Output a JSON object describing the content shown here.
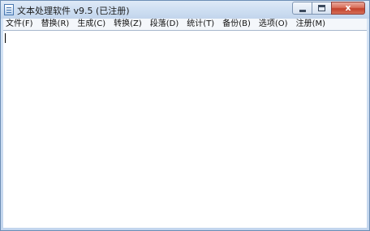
{
  "window": {
    "title": "文本处理软件 v9.5 (已注册)",
    "icon": "document-icon",
    "caption_buttons": {
      "minimize_icon": "minimize-icon",
      "maximize_icon": "maximize-icon",
      "close_glyph": "x"
    }
  },
  "menu": {
    "items": [
      {
        "label": "文件(F)"
      },
      {
        "label": "替换(R)"
      },
      {
        "label": "生成(C)"
      },
      {
        "label": "转换(Z)"
      },
      {
        "label": "段落(D)"
      },
      {
        "label": "统计(T)"
      },
      {
        "label": "备份(B)"
      },
      {
        "label": "选项(O)"
      },
      {
        "label": "注册(M)"
      }
    ]
  },
  "editor": {
    "text": ""
  },
  "colors": {
    "frame": "#c3d6ee",
    "close_button": "#c2412b",
    "editor_background": "#ffffff"
  }
}
